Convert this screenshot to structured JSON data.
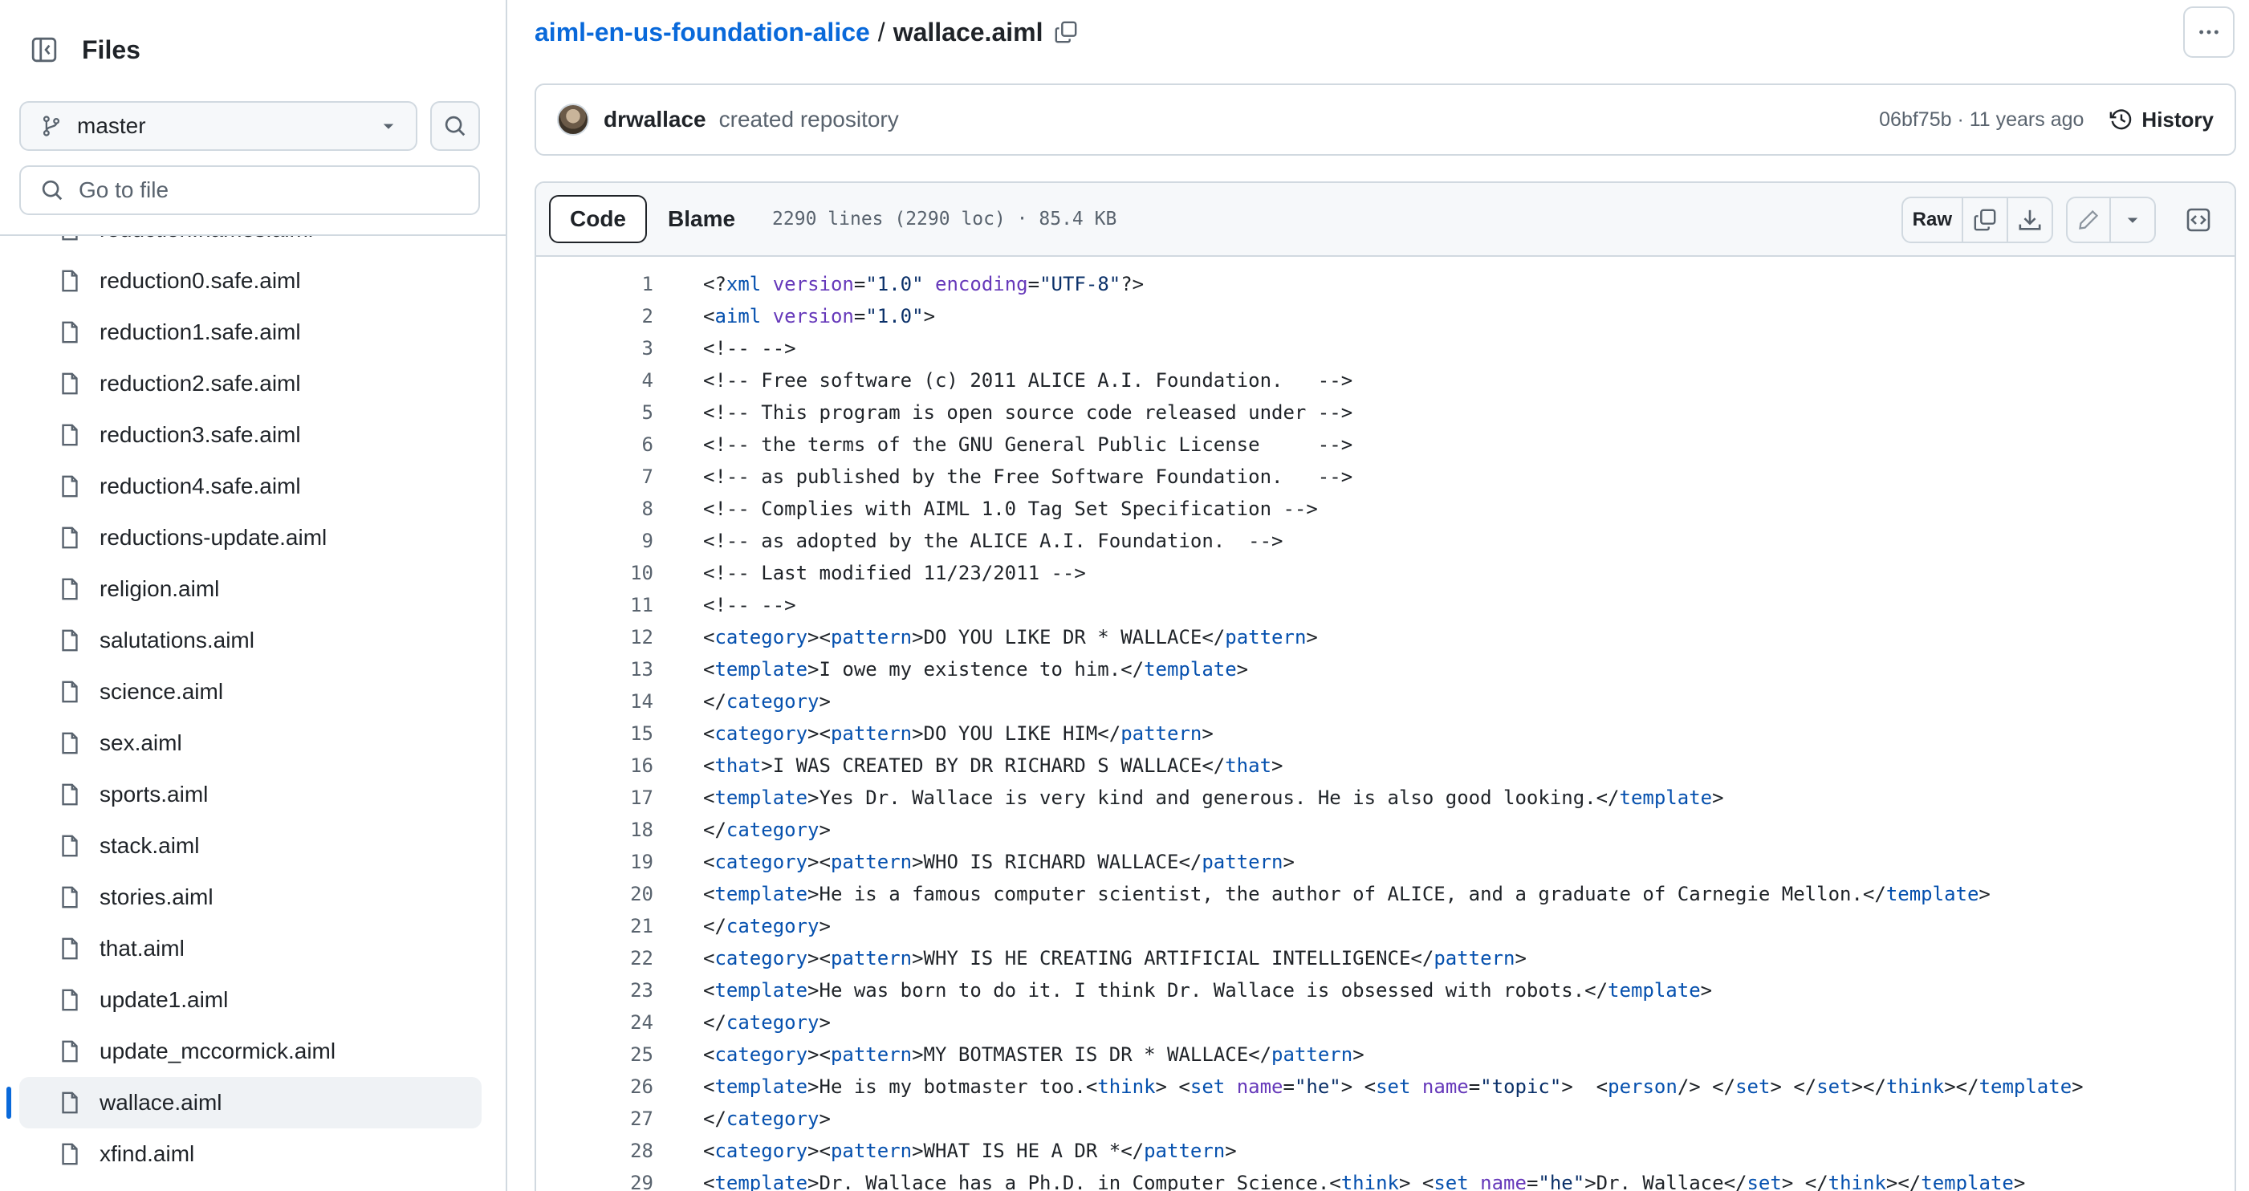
{
  "sidebar": {
    "title": "Files",
    "branch": "master",
    "go_to_file_placeholder": "Go to file",
    "files": [
      {
        "name": "reduction.names.aiml",
        "active": false
      },
      {
        "name": "reduction0.safe.aiml",
        "active": false
      },
      {
        "name": "reduction1.safe.aiml",
        "active": false
      },
      {
        "name": "reduction2.safe.aiml",
        "active": false
      },
      {
        "name": "reduction3.safe.aiml",
        "active": false
      },
      {
        "name": "reduction4.safe.aiml",
        "active": false
      },
      {
        "name": "reductions-update.aiml",
        "active": false
      },
      {
        "name": "religion.aiml",
        "active": false
      },
      {
        "name": "salutations.aiml",
        "active": false
      },
      {
        "name": "science.aiml",
        "active": false
      },
      {
        "name": "sex.aiml",
        "active": false
      },
      {
        "name": "sports.aiml",
        "active": false
      },
      {
        "name": "stack.aiml",
        "active": false
      },
      {
        "name": "stories.aiml",
        "active": false
      },
      {
        "name": "that.aiml",
        "active": false
      },
      {
        "name": "update1.aiml",
        "active": false
      },
      {
        "name": "update_mccormick.aiml",
        "active": false
      },
      {
        "name": "wallace.aiml",
        "active": true
      },
      {
        "name": "xfind.aiml",
        "active": false
      }
    ]
  },
  "breadcrumb": {
    "repo": "aiml-en-us-foundation-alice",
    "separator": "/",
    "file": "wallace.aiml"
  },
  "commit": {
    "author": "drwallace",
    "message": "created repository",
    "sha_age": "06bf75b · 11 years ago",
    "history_label": "History"
  },
  "file_header": {
    "tabs": [
      {
        "label": "Code",
        "selected": true
      },
      {
        "label": "Blame",
        "selected": false
      }
    ],
    "info": "2290 lines (2290 loc) · 85.4 KB",
    "raw_label": "Raw"
  },
  "code_lines": [
    [
      {
        "t": "<?"
      },
      {
        "t": "xml",
        "c": "tg"
      },
      {
        "t": " "
      },
      {
        "t": "version",
        "c": "at"
      },
      {
        "t": "="
      },
      {
        "t": "\"1.0\"",
        "c": "sv"
      },
      {
        "t": " "
      },
      {
        "t": "encoding",
        "c": "at"
      },
      {
        "t": "="
      },
      {
        "t": "\"UTF-8\"",
        "c": "sv"
      },
      {
        "t": "?>"
      }
    ],
    [
      {
        "t": "<"
      },
      {
        "t": "aiml",
        "c": "tg"
      },
      {
        "t": " "
      },
      {
        "t": "version",
        "c": "at"
      },
      {
        "t": "="
      },
      {
        "t": "\"1.0\"",
        "c": "sv"
      },
      {
        "t": ">"
      }
    ],
    [
      {
        "t": "<!-- -->"
      }
    ],
    [
      {
        "t": "<!-- Free software (c) 2011 ALICE A.I. Foundation.   -->"
      }
    ],
    [
      {
        "t": "<!-- This program is open source code released under -->"
      }
    ],
    [
      {
        "t": "<!-- the terms of the GNU General Public License     -->"
      }
    ],
    [
      {
        "t": "<!-- as published by the Free Software Foundation.   -->"
      }
    ],
    [
      {
        "t": "<!-- Complies with AIML 1.0 Tag Set Specification -->"
      }
    ],
    [
      {
        "t": "<!-- as adopted by the ALICE A.I. Foundation.  -->"
      }
    ],
    [
      {
        "t": "<!-- Last modified 11/23/2011 -->"
      }
    ],
    [
      {
        "t": "<!-- -->"
      }
    ],
    [
      {
        "t": "<"
      },
      {
        "t": "category",
        "c": "tg"
      },
      {
        "t": "><"
      },
      {
        "t": "pattern",
        "c": "tg"
      },
      {
        "t": ">DO YOU LIKE DR * WALLACE</"
      },
      {
        "t": "pattern",
        "c": "tg"
      },
      {
        "t": ">"
      }
    ],
    [
      {
        "t": "<"
      },
      {
        "t": "template",
        "c": "tg"
      },
      {
        "t": ">I owe my existence to him.</"
      },
      {
        "t": "template",
        "c": "tg"
      },
      {
        "t": ">"
      }
    ],
    [
      {
        "t": "</"
      },
      {
        "t": "category",
        "c": "tg"
      },
      {
        "t": ">"
      }
    ],
    [
      {
        "t": "<"
      },
      {
        "t": "category",
        "c": "tg"
      },
      {
        "t": "><"
      },
      {
        "t": "pattern",
        "c": "tg"
      },
      {
        "t": ">DO YOU LIKE HIM</"
      },
      {
        "t": "pattern",
        "c": "tg"
      },
      {
        "t": ">"
      }
    ],
    [
      {
        "t": "<"
      },
      {
        "t": "that",
        "c": "tg"
      },
      {
        "t": ">I WAS CREATED BY DR RICHARD S WALLACE</"
      },
      {
        "t": "that",
        "c": "tg"
      },
      {
        "t": ">"
      }
    ],
    [
      {
        "t": "<"
      },
      {
        "t": "template",
        "c": "tg"
      },
      {
        "t": ">Yes Dr. Wallace is very kind and generous. He is also good looking.</"
      },
      {
        "t": "template",
        "c": "tg"
      },
      {
        "t": ">"
      }
    ],
    [
      {
        "t": "</"
      },
      {
        "t": "category",
        "c": "tg"
      },
      {
        "t": ">"
      }
    ],
    [
      {
        "t": "<"
      },
      {
        "t": "category",
        "c": "tg"
      },
      {
        "t": "><"
      },
      {
        "t": "pattern",
        "c": "tg"
      },
      {
        "t": ">WHO IS RICHARD WALLACE</"
      },
      {
        "t": "pattern",
        "c": "tg"
      },
      {
        "t": ">"
      }
    ],
    [
      {
        "t": "<"
      },
      {
        "t": "template",
        "c": "tg"
      },
      {
        "t": ">He is a famous computer scientist, the author of ALICE, and a graduate of Carnegie Mellon.</"
      },
      {
        "t": "template",
        "c": "tg"
      },
      {
        "t": ">"
      }
    ],
    [
      {
        "t": "</"
      },
      {
        "t": "category",
        "c": "tg"
      },
      {
        "t": ">"
      }
    ],
    [
      {
        "t": "<"
      },
      {
        "t": "category",
        "c": "tg"
      },
      {
        "t": "><"
      },
      {
        "t": "pattern",
        "c": "tg"
      },
      {
        "t": ">WHY IS HE CREATING ARTIFICIAL INTELLIGENCE</"
      },
      {
        "t": "pattern",
        "c": "tg"
      },
      {
        "t": ">"
      }
    ],
    [
      {
        "t": "<"
      },
      {
        "t": "template",
        "c": "tg"
      },
      {
        "t": ">He was born to do it. I think Dr. Wallace is obsessed with robots.</"
      },
      {
        "t": "template",
        "c": "tg"
      },
      {
        "t": ">"
      }
    ],
    [
      {
        "t": "</"
      },
      {
        "t": "category",
        "c": "tg"
      },
      {
        "t": ">"
      }
    ],
    [
      {
        "t": "<"
      },
      {
        "t": "category",
        "c": "tg"
      },
      {
        "t": "><"
      },
      {
        "t": "pattern",
        "c": "tg"
      },
      {
        "t": ">MY BOTMASTER IS DR * WALLACE</"
      },
      {
        "t": "pattern",
        "c": "tg"
      },
      {
        "t": ">"
      }
    ],
    [
      {
        "t": "<"
      },
      {
        "t": "template",
        "c": "tg"
      },
      {
        "t": ">He is my botmaster too.<"
      },
      {
        "t": "think",
        "c": "tg"
      },
      {
        "t": "> <"
      },
      {
        "t": "set",
        "c": "tg"
      },
      {
        "t": " "
      },
      {
        "t": "name",
        "c": "at"
      },
      {
        "t": "="
      },
      {
        "t": "\"he\"",
        "c": "sv"
      },
      {
        "t": "> <"
      },
      {
        "t": "set",
        "c": "tg"
      },
      {
        "t": " "
      },
      {
        "t": "name",
        "c": "at"
      },
      {
        "t": "="
      },
      {
        "t": "\"topic\"",
        "c": "sv"
      },
      {
        "t": ">  <"
      },
      {
        "t": "person",
        "c": "tg"
      },
      {
        "t": "/> </"
      },
      {
        "t": "set",
        "c": "tg"
      },
      {
        "t": "> </"
      },
      {
        "t": "set",
        "c": "tg"
      },
      {
        "t": "></"
      },
      {
        "t": "think",
        "c": "tg"
      },
      {
        "t": "></"
      },
      {
        "t": "template",
        "c": "tg"
      },
      {
        "t": ">"
      }
    ],
    [
      {
        "t": "</"
      },
      {
        "t": "category",
        "c": "tg"
      },
      {
        "t": ">"
      }
    ],
    [
      {
        "t": "<"
      },
      {
        "t": "category",
        "c": "tg"
      },
      {
        "t": "><"
      },
      {
        "t": "pattern",
        "c": "tg"
      },
      {
        "t": ">WHAT IS HE A DR *</"
      },
      {
        "t": "pattern",
        "c": "tg"
      },
      {
        "t": ">"
      }
    ],
    [
      {
        "t": "<"
      },
      {
        "t": "template",
        "c": "tg"
      },
      {
        "t": ">Dr. Wallace has a Ph.D. in Computer Science.<"
      },
      {
        "t": "think",
        "c": "tg"
      },
      {
        "t": "> <"
      },
      {
        "t": "set",
        "c": "tg"
      },
      {
        "t": " "
      },
      {
        "t": "name",
        "c": "at"
      },
      {
        "t": "="
      },
      {
        "t": "\"he\"",
        "c": "sv"
      },
      {
        "t": ">Dr. Wallace</"
      },
      {
        "t": "set",
        "c": "tg"
      },
      {
        "t": "> </"
      },
      {
        "t": "think",
        "c": "tg"
      },
      {
        "t": "></"
      },
      {
        "t": "template",
        "c": "tg"
      },
      {
        "t": ">"
      }
    ]
  ],
  "colors": {
    "link": "#0969da",
    "tag": "#0550ae",
    "attr": "#6639ba",
    "string": "#0a3069",
    "border": "#d1d9e0",
    "muted": "#59636e"
  }
}
